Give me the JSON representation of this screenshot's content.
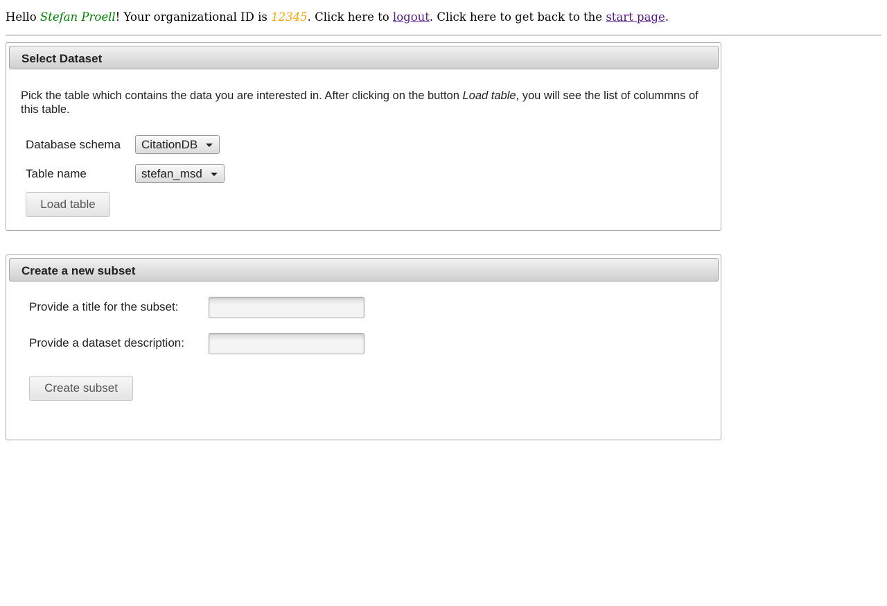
{
  "header": {
    "hello": "Hello ",
    "user_name": "Stefan Proell",
    "org_text": "! Your organizational ID is ",
    "org_id": "12345",
    "logout_prefix": ". Click here to ",
    "logout_link": "logout",
    "start_prefix": ". Click here to get back to the ",
    "start_link": "start page",
    "end": "."
  },
  "select_dataset": {
    "title": "Select Dataset",
    "description_before": "Pick the table which contains the data you are interested in. After clicking on the button ",
    "description_emph": "Load table",
    "description_after": ", you will see the list of colummns of this table.",
    "schema_label": "Database schema",
    "schema_value": "CitationDB",
    "table_label": "Table name",
    "table_value": "stefan_msd",
    "load_button": "Load table"
  },
  "create_subset": {
    "title": "Create a new subset",
    "title_label": "Provide a title for the subset:",
    "title_value": "",
    "description_label": "Provide a dataset description:",
    "description_value": "",
    "create_button": "Create subset"
  },
  "colors": {
    "user_name": "#008000",
    "org_id": "#ffa500",
    "link": "#551a8b"
  }
}
